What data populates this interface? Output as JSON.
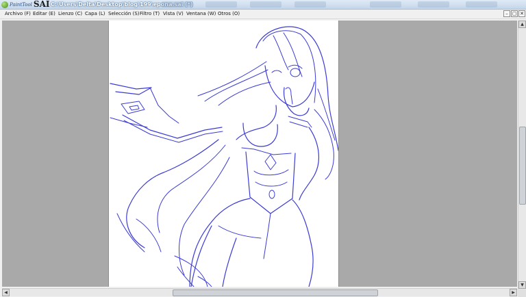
{
  "app": {
    "brand_small": "PaintTool",
    "brand_large": "SAI"
  },
  "window": {
    "title": "C:\\Users\\Delta\\Desktop\\blog\\199\\epona.sai (*)"
  },
  "menu": [
    {
      "label": "Archivo (F)"
    },
    {
      "label": "Editar (E)"
    },
    {
      "label": "Lienzo (C)"
    },
    {
      "label": "Capa (L)"
    },
    {
      "label": "Selección (S)"
    },
    {
      "label": "Filtro (T)"
    },
    {
      "label": "Vista (V)"
    },
    {
      "label": "Ventana (W)"
    },
    {
      "label": "Otros (O)"
    }
  ],
  "window_buttons": {
    "minimize": "–",
    "restore": "▢",
    "close": "✕"
  },
  "scroll": {
    "up": "▲",
    "down": "▼",
    "left": "◀",
    "right": "▶"
  },
  "canvas": {
    "subject": "blue line sketch of a woman holding a spear",
    "stroke_color": "#3a3ad6"
  }
}
